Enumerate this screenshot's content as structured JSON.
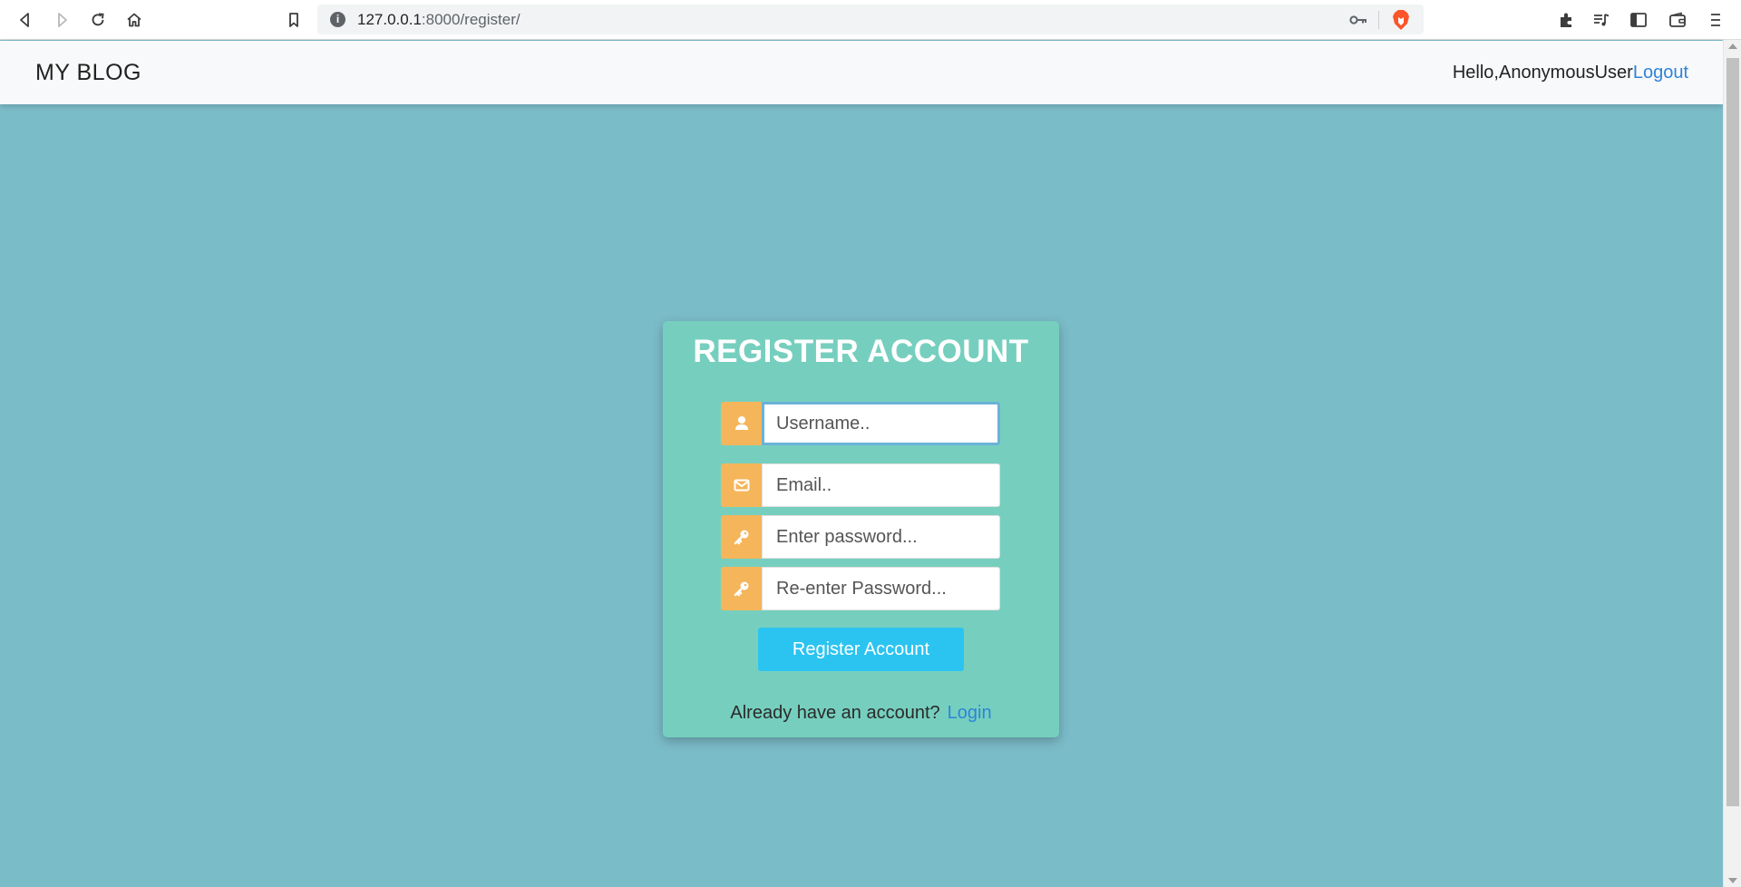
{
  "browser": {
    "url_host": "127.0.0.1",
    "url_rest": ":8000/register/",
    "info_icon": "i",
    "icons": [
      "back-icon",
      "forward-icon",
      "reload-icon",
      "home-icon",
      "bookmark-icon",
      "key-icon",
      "brave-shield-icon",
      "extensions-icon",
      "playlist-icon",
      "sidebar-icon",
      "wallet-icon",
      "menu-icon"
    ]
  },
  "navbar": {
    "brand": "MY BLOG",
    "greeting": "Hello,AnonymousUser",
    "logout_label": "Logout"
  },
  "register": {
    "title": "REGISTER ACCOUNT",
    "username_placeholder": "Username..",
    "email_placeholder": "Email..",
    "password_placeholder": "Enter password...",
    "password2_placeholder": "Re-enter Password...",
    "submit_label": "Register Account",
    "footer_text": "Already have an account?",
    "login_label": "Login"
  },
  "colors": {
    "page_bg": "#7bbcc9",
    "card_bg": "#76cfbe",
    "icon_bg": "#f5b55a",
    "button_bg": "#2bc4f0",
    "link": "#2f83d8"
  }
}
